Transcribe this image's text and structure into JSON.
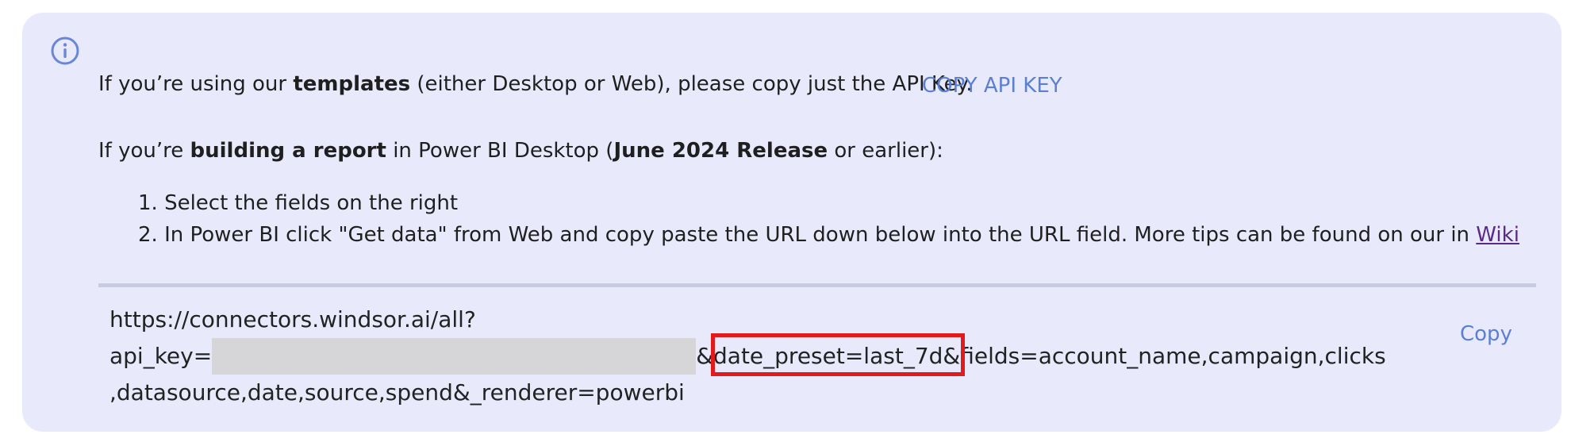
{
  "notice": {
    "line1": {
      "pre": "If you’re using our ",
      "bold": "templates",
      "post": " (either Desktop or Web), please copy just the API Key.",
      "copy_api_key": "COPY API KEY"
    },
    "line2": {
      "pre": "If you’re ",
      "bold1": "building a report",
      "mid": " in Power BI Desktop (",
      "bold2": "June 2024 Release",
      "post": " or earlier):"
    },
    "steps": [
      "1. Select the fields on the right",
      "2. In Power BI click \"Get data\" from Web and copy paste the URL down below into the URL field. More tips can be found on our in "
    ],
    "wiki_link": "Wiki"
  },
  "url": {
    "line1": "https://connectors.windsor.ai/all?",
    "line2_prefix": "api_key=",
    "line2_after_redaction": "&date_preset=last_7d&fields=account_name,campaign,clicks",
    "line3": ",datasource,date,source,spend&_renderer=powerbi",
    "copy_label": "Copy"
  },
  "colors": {
    "panel_bg": "#e8eafc",
    "link": "#5b7fd1",
    "highlight_border": "#e11b1b"
  },
  "icons": {
    "info": "info-circle-icon"
  }
}
